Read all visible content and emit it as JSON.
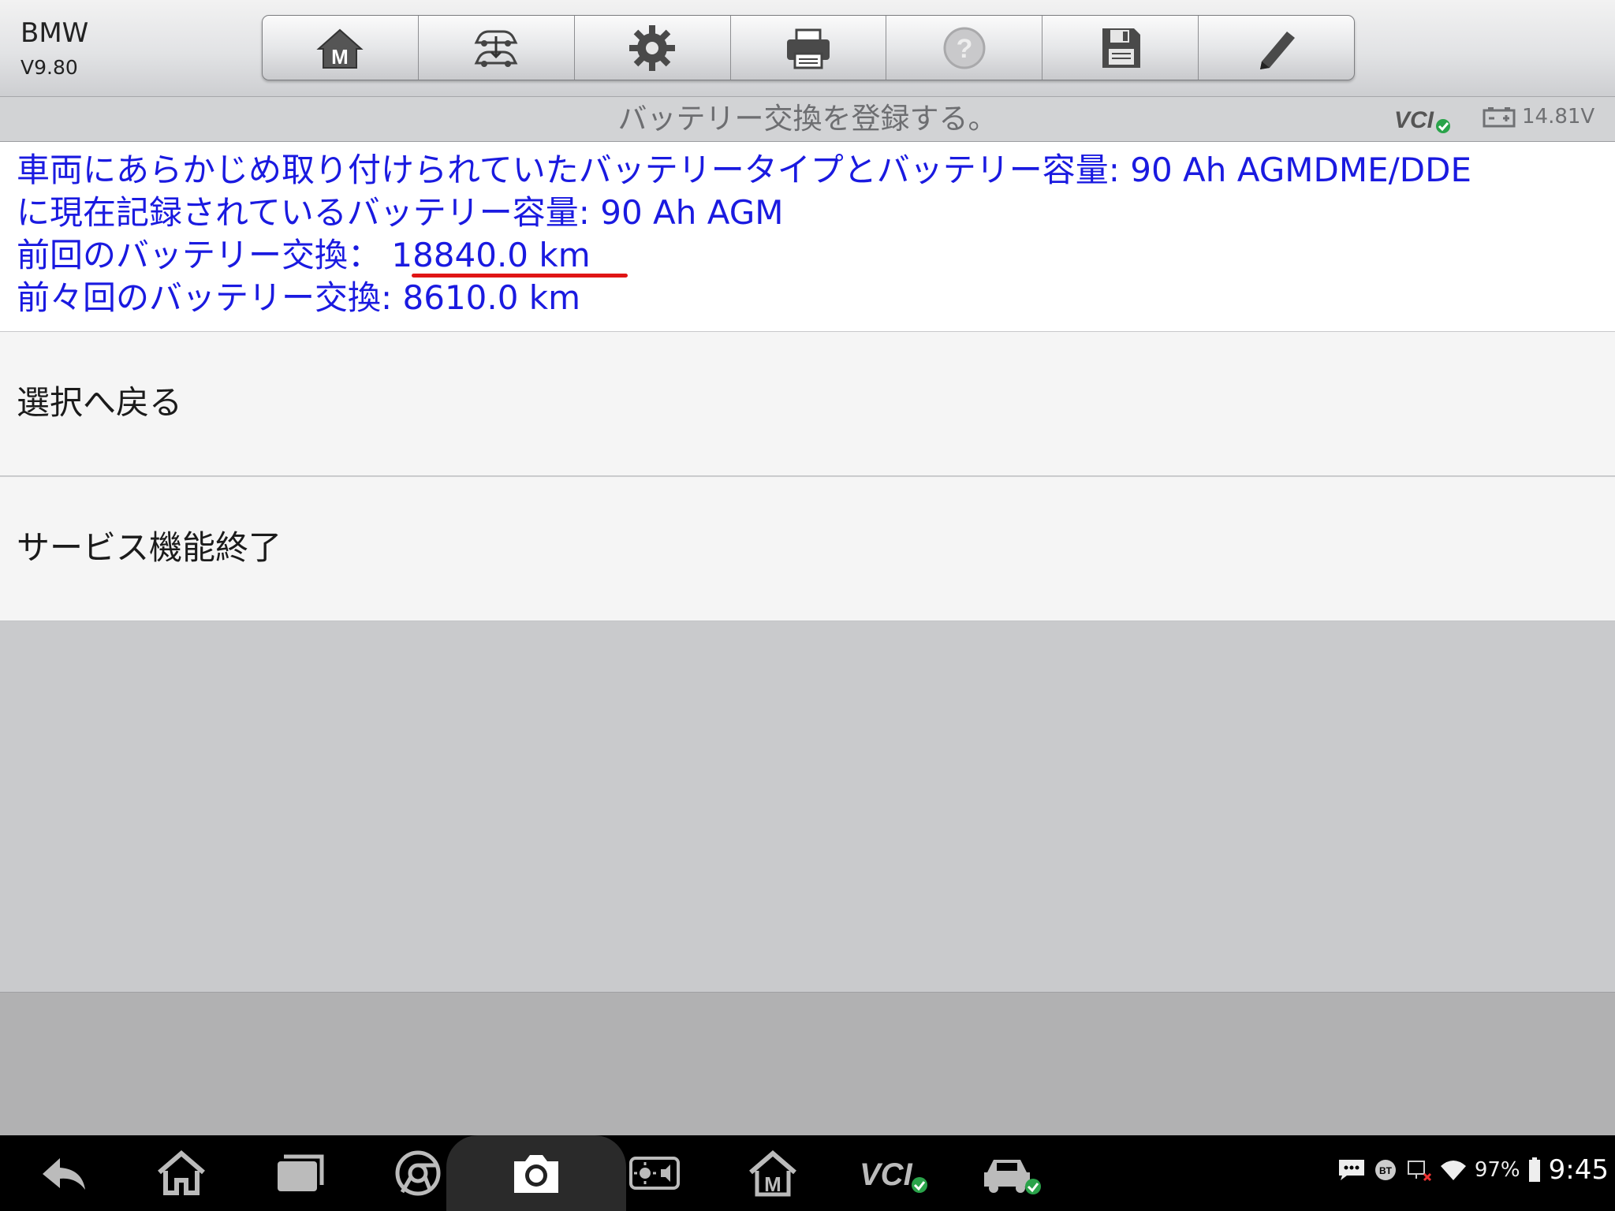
{
  "header": {
    "brand": "BMW",
    "version": "V9.80",
    "toolbar": [
      {
        "icon": "home-m-icon",
        "name": "home"
      },
      {
        "icon": "vehicle-swap-icon",
        "name": "vehicle-swap"
      },
      {
        "icon": "gear-icon",
        "name": "settings"
      },
      {
        "icon": "printer-icon",
        "name": "print"
      },
      {
        "icon": "help-icon",
        "name": "help"
      },
      {
        "icon": "save-icon",
        "name": "save"
      },
      {
        "icon": "pencil-icon",
        "name": "edit"
      }
    ]
  },
  "titlebar": {
    "title": "バッテリー交換を登録する。",
    "voltage": "14.81V"
  },
  "info": {
    "line1": "車両にあらかじめ取り付けられていたバッテリータイプとバッテリー容量: 90 Ah AGMDME/DDE",
    "line2": "に現在記録されているバッテリー容量: 90 Ah AGM",
    "line3": "前回のバッテリー交換： 18840.0 km",
    "line4": "前々回のバッテリー交換: 8610.0 km"
  },
  "menu": {
    "back": "選択へ戻る",
    "exit": "サービス機能終了"
  },
  "statusbar": {
    "battery": "97%",
    "time": "9:45"
  },
  "colors": {
    "info_text": "#1a1ae0",
    "underline": "#e01515",
    "vcl_ok": "#2aa34a"
  }
}
